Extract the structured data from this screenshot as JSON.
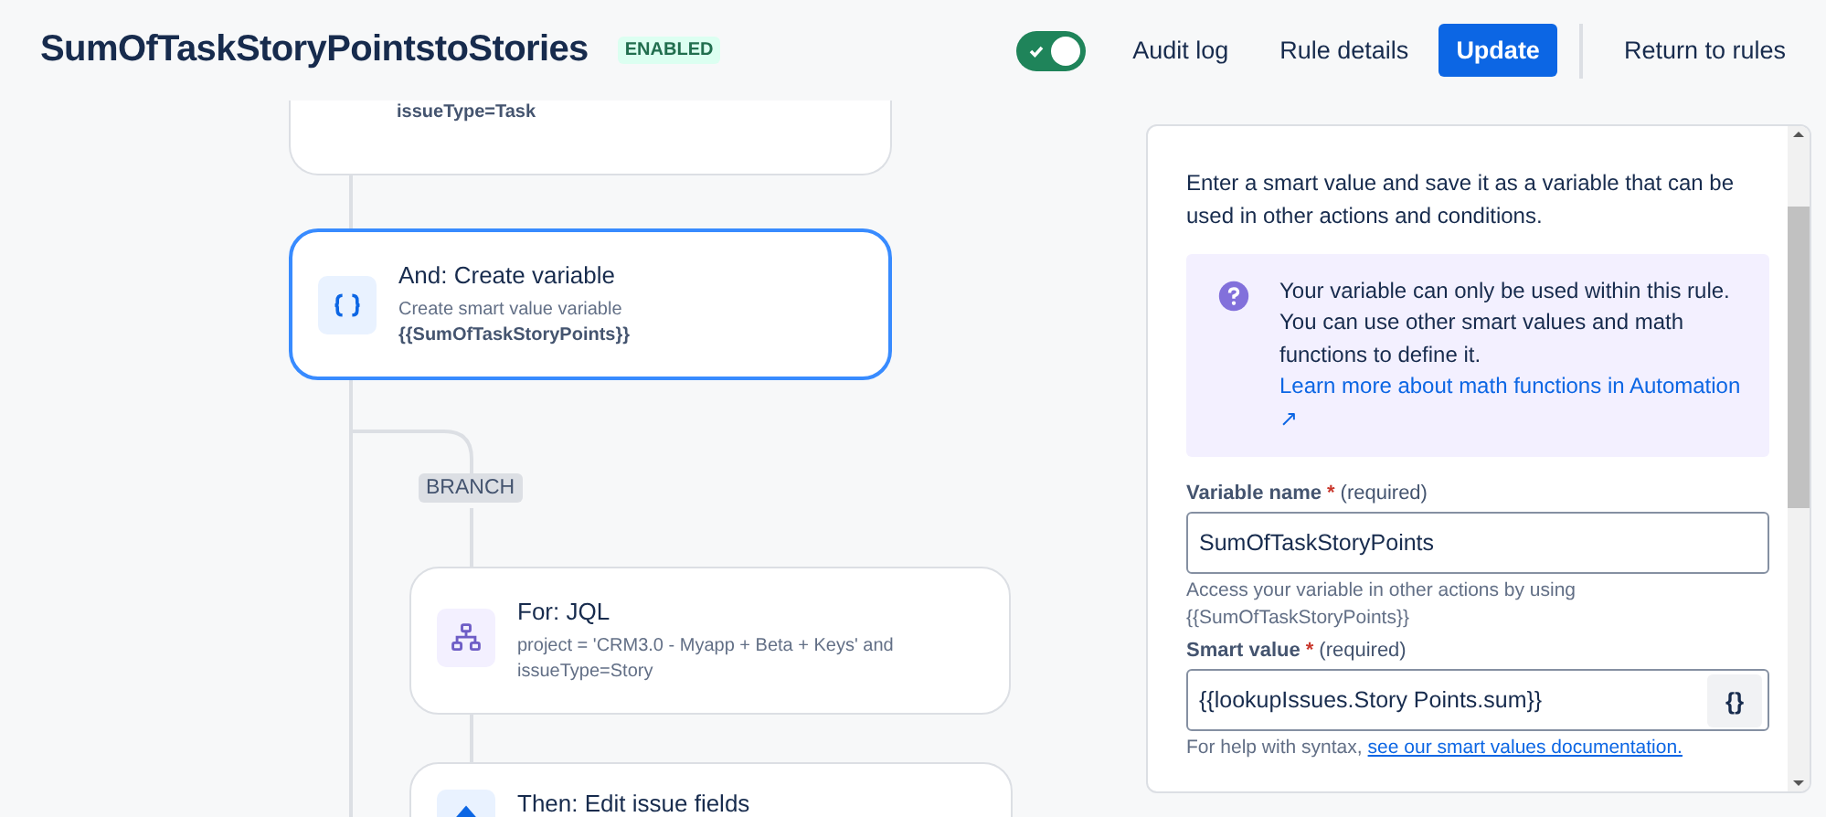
{
  "header": {
    "title": "SumOfTaskStoryPointstoStories",
    "status": "ENABLED",
    "toggle": {
      "on": true
    },
    "links": [
      "Audit log",
      "Rule details"
    ],
    "primary_button": "Update",
    "return_button": "Return to rules"
  },
  "canvas": {
    "nodes": [
      {
        "kind": "condition",
        "lines": [
          {
            "text": "issueType=Task",
            "bold": true
          }
        ],
        "selected": false
      },
      {
        "kind": "variable",
        "title": "And: Create variable",
        "lines": [
          {
            "text": "Create smart value variable",
            "bold": false
          },
          {
            "text": "{{SumOfTaskStoryPoints}}",
            "bold": true
          }
        ],
        "selected": true
      },
      {
        "kind": "branch",
        "title": "For: JQL",
        "lines": [
          {
            "text": "project = 'CRM3.0 - Myapp + Beta + Keys' and issueType=Story",
            "bold": false
          }
        ],
        "selected": false
      },
      {
        "kind": "edit",
        "title": "Then: Edit issue fields",
        "selected": false
      }
    ],
    "branch_label": "BRANCH"
  },
  "panel": {
    "intro": "Enter a smart value and save it as a variable that can be used in other actions and conditions.",
    "info": {
      "text": "Your variable can only be used within this rule. You can use other smart values and math functions to define it.",
      "link": "Learn more about math functions in Automation ↗"
    },
    "fields": [
      {
        "label": "Variable name",
        "required_mark": "*",
        "required": "(required)",
        "value": "SumOfTaskStoryPoints",
        "help": "Access your variable in other actions by using {{SumOfTaskStoryPoints}}"
      },
      {
        "label": "Smart value",
        "required_mark": "*",
        "required": "(required)",
        "value": "{{lookupIssues.Story Points.sum}}",
        "help": "For help with syntax,",
        "help_link": "see our smart values documentation.",
        "button": "{}"
      }
    ]
  }
}
